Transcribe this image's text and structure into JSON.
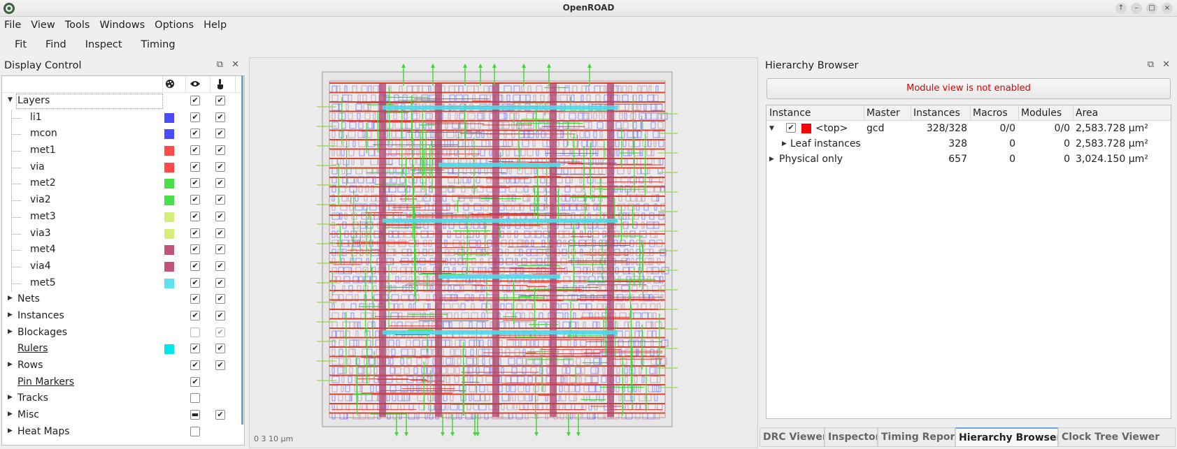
{
  "window": {
    "title": "OpenROAD"
  },
  "menu": [
    "File",
    "View",
    "Tools",
    "Windows",
    "Options",
    "Help"
  ],
  "toolbar": [
    "Fit",
    "Find",
    "Inspect",
    "Timing"
  ],
  "display_control": {
    "title": "Display Control",
    "header_icons": [
      "palette-icon",
      "eye-icon",
      "pointer-icon"
    ],
    "rows": [
      {
        "label": "Layers",
        "indent": 0,
        "expanded": true,
        "arrow": true,
        "visible": true,
        "selectable": true,
        "focused": true
      },
      {
        "label": "li1",
        "indent": 1,
        "color": "#4a4aff",
        "visible": true,
        "selectable": true
      },
      {
        "label": "mcon",
        "indent": 1,
        "color": "#4a4aff",
        "visible": true,
        "selectable": true
      },
      {
        "label": "met1",
        "indent": 1,
        "color": "#ff4a4a",
        "visible": true,
        "selectable": true
      },
      {
        "label": "via",
        "indent": 1,
        "color": "#ff4a4a",
        "visible": true,
        "selectable": true
      },
      {
        "label": "met2",
        "indent": 1,
        "color": "#4ade4a",
        "visible": true,
        "selectable": true
      },
      {
        "label": "via2",
        "indent": 1,
        "color": "#4ade4a",
        "visible": true,
        "selectable": true
      },
      {
        "label": "met3",
        "indent": 1,
        "color": "#d6ee7a",
        "visible": true,
        "selectable": true
      },
      {
        "label": "via3",
        "indent": 1,
        "color": "#d6ee7a",
        "visible": true,
        "selectable": true
      },
      {
        "label": "met4",
        "indent": 1,
        "color": "#bf5578",
        "visible": true,
        "selectable": true
      },
      {
        "label": "via4",
        "indent": 1,
        "color": "#bf5578",
        "visible": true,
        "selectable": true
      },
      {
        "label": "met5",
        "indent": 1,
        "color": "#5fe0f0",
        "visible": true,
        "selectable": true
      },
      {
        "label": "Nets",
        "indent": 0,
        "arrow": true,
        "visible": true,
        "selectable": true
      },
      {
        "label": "Instances",
        "indent": 0,
        "arrow": true,
        "visible": true,
        "selectable": true
      },
      {
        "label": "Blockages",
        "indent": 0,
        "arrow": true,
        "visible": false,
        "selectable": true,
        "selectable_disabled": true,
        "visible_disabled": true
      },
      {
        "label": "Rulers",
        "indent": 0,
        "underline": true,
        "color": "#00e5ee",
        "visible": true,
        "selectable": true
      },
      {
        "label": "Rows",
        "indent": 0,
        "arrow": true,
        "visible": true,
        "selectable": true
      },
      {
        "label": "Pin Markers",
        "indent": 0,
        "underline": true,
        "visible": true
      },
      {
        "label": "Tracks",
        "indent": 0,
        "arrow": true,
        "visible": false
      },
      {
        "label": "Misc",
        "indent": 0,
        "arrow": true,
        "visible": "partial",
        "selectable": true
      },
      {
        "label": "Heat Maps",
        "indent": 0,
        "arrow": true,
        "visible": false
      }
    ]
  },
  "layout": {
    "scale_label": "0   3   10 μm"
  },
  "hierarchy_browser": {
    "title": "Hierarchy Browser",
    "notice": "Module view is not enabled",
    "columns": [
      "Instance",
      "Master",
      "Instances",
      "Macros",
      "Modules",
      "Area"
    ],
    "rows": [
      {
        "name": "<top>",
        "master": "gcd",
        "instances": "328/328",
        "macros": "0/0",
        "modules": "0/0",
        "area": "2,583.728 μm²",
        "level": 0,
        "expanded": true,
        "checkbox": true,
        "color": "#ff0000"
      },
      {
        "name": "Leaf instances",
        "master": "",
        "instances": "328",
        "macros": "0",
        "modules": "0",
        "area": "2,583.728 μm²",
        "level": 1
      },
      {
        "name": "Physical only",
        "master": "",
        "instances": "657",
        "macros": "0",
        "modules": "0",
        "area": "3,024.150 μm²",
        "level": 0
      }
    ]
  },
  "tabs": [
    {
      "label": "DRC Viewer",
      "active": false
    },
    {
      "label": "Inspector",
      "active": false
    },
    {
      "label": "Timing Report",
      "active": false
    },
    {
      "label": "Hierarchy Browser",
      "active": true
    },
    {
      "label": "Clock Tree Viewer",
      "active": false
    }
  ]
}
